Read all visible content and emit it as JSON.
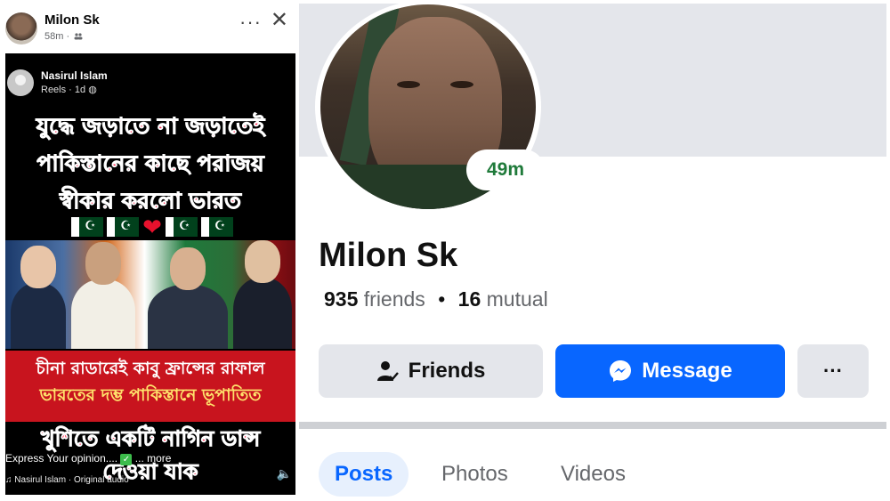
{
  "post": {
    "author": "Milon Sk",
    "time": "58m",
    "more_label": "···",
    "close_label": "✕",
    "reel": {
      "author": "Nasirul Islam",
      "meta": "Reels · 1d",
      "headline_lines": [
        "যুদ্ধে জড়াতে না জড়াতেই",
        "পাকিস্তানের কাছে পরাজয়",
        "স্বীকার করলো ভারত"
      ],
      "band_lines": [
        "চীনা রাডারেই কাবু ফ্রান্সের রাফাল",
        "ভারতের দম্ভ পাকিস্তানে ভূপাতিত"
      ],
      "bottom_lines": [
        "খুশিতে একটি নাগিন ডান্স",
        "দেওয়া যাক"
      ],
      "caption": "Express Your opinion....",
      "caption_more": "... more",
      "audio": "Nasirul Islam · Original audio"
    }
  },
  "profile": {
    "name": "Milon Sk",
    "active_badge": "49m",
    "friends_count": "935",
    "friends_label": "friends",
    "mutual_count": "16",
    "mutual_label": "mutual",
    "buttons": {
      "friends": "Friends",
      "message": "Message",
      "more": "···"
    },
    "tabs": [
      "Posts",
      "Photos",
      "Videos"
    ]
  },
  "colors": {
    "accent": "#0866ff",
    "active_green": "#1f7a3a",
    "headline_red": "#ff2d55"
  },
  "icons": [
    "friends-audience-icon",
    "globe-icon",
    "friend-check-icon",
    "messenger-icon",
    "music-note-icon",
    "speaker-icon"
  ]
}
